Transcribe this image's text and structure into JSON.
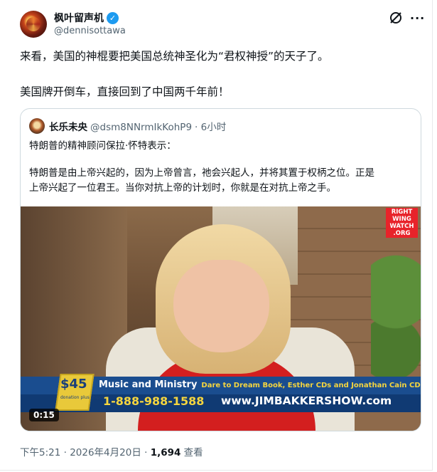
{
  "author": {
    "display_name": "枫叶留声机",
    "handle": "@dennisottawa",
    "verified_glyph": "✓"
  },
  "header_icons": {
    "grok": "grok-icon",
    "more": "···"
  },
  "tweet": {
    "line1": "来看，美国的神棍要把美国总统神圣化为“君权神授”的天子了。",
    "line2": "美国牌开倒车，直接回到了中国两千年前！"
  },
  "quote": {
    "display_name": "长乐未央",
    "handle": "@dsm8NNrmIkKohP9",
    "time": "· 6小时",
    "line1": "特朗普的精神顾问保拉·怀特表示：",
    "line2": "特朗普是由上帝兴起的，因为上帝曾言，祂会兴起人，并将其置于权柄之位。正是",
    "line3": "上帝兴起了一位君王。当你对抗上帝的计划时，你就是在对抗上帝之手。",
    "video": {
      "watermark": [
        "RIGHT",
        "WING",
        "WATCH",
        ".ORG"
      ],
      "price": "$45",
      "price_sub": "donation plus shipping",
      "title": "Music and Ministry",
      "subtitle": "Dare to Dream Book, Esther CDs and Jonathan Cain CD",
      "phone": "1-888-988-1588",
      "site": "www.JIMBAKKERSHOW.com",
      "duration": "0:15"
    }
  },
  "meta": {
    "time_date": "下午5:21 · 2026年4月20日 · ",
    "views": "1,694",
    "views_label": " 查看"
  },
  "colors": {
    "accent": "#1d9bf0",
    "secondary_text": "#536471",
    "border": "#cfd9de"
  }
}
